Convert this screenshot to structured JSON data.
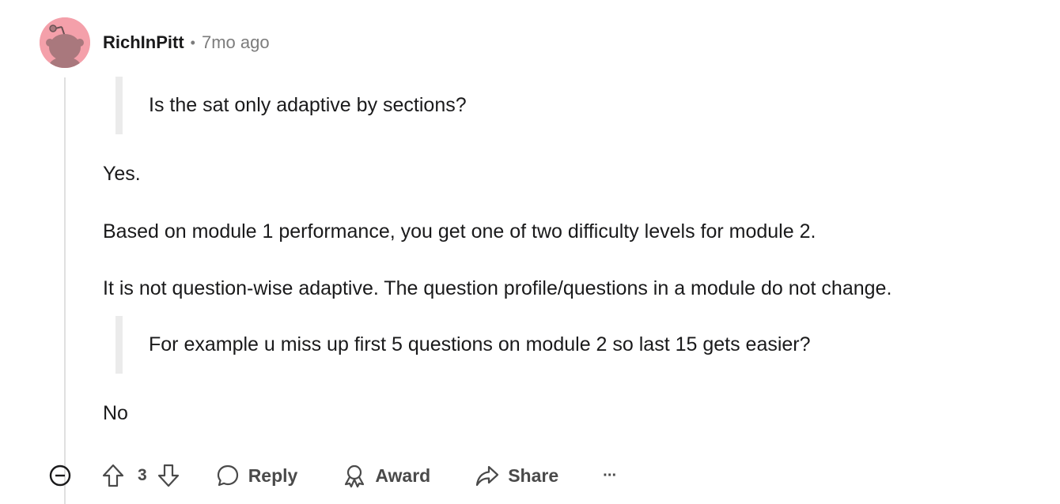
{
  "comment": {
    "author": "RichInPitt",
    "separator": "•",
    "timestamp": "7mo ago",
    "quote1": "Is the sat only adaptive by sections?",
    "para1": "Yes.",
    "para2": "Based on module 1 performance, you get one of two difficulty levels for module 2.",
    "para3": "It is not question-wise adaptive. The question profile/questions in a module do not change.",
    "quote2": "For example u miss up first 5 questions on module 2 so last 15 gets easier?",
    "para4": "No"
  },
  "actions": {
    "collapse_icon": "collapse-icon",
    "upvote_icon": "upvote-icon",
    "score": "3",
    "downvote_icon": "downvote-icon",
    "reply_label": "Reply",
    "award_label": "Award",
    "share_label": "Share",
    "more_label": "···"
  },
  "colors": {
    "avatar_bg": "#f4a0aa",
    "text": "#1a1a1b",
    "muted": "#7c7c7c",
    "quote_bar": "#ebebeb"
  }
}
